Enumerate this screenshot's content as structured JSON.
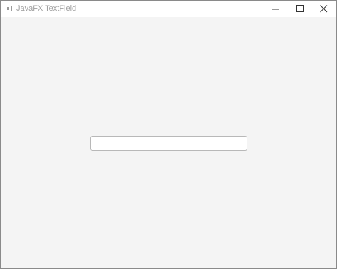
{
  "window": {
    "title": "JavaFX TextField",
    "controls": {
      "minimize_icon": "minimize-icon",
      "maximize_icon": "maximize-icon",
      "close_icon": "close-icon"
    }
  },
  "textfield": {
    "value": "",
    "placeholder": ""
  },
  "colors": {
    "background": "#f4f4f4",
    "titlebar": "#ffffff",
    "field_border": "#b8b8b8"
  }
}
